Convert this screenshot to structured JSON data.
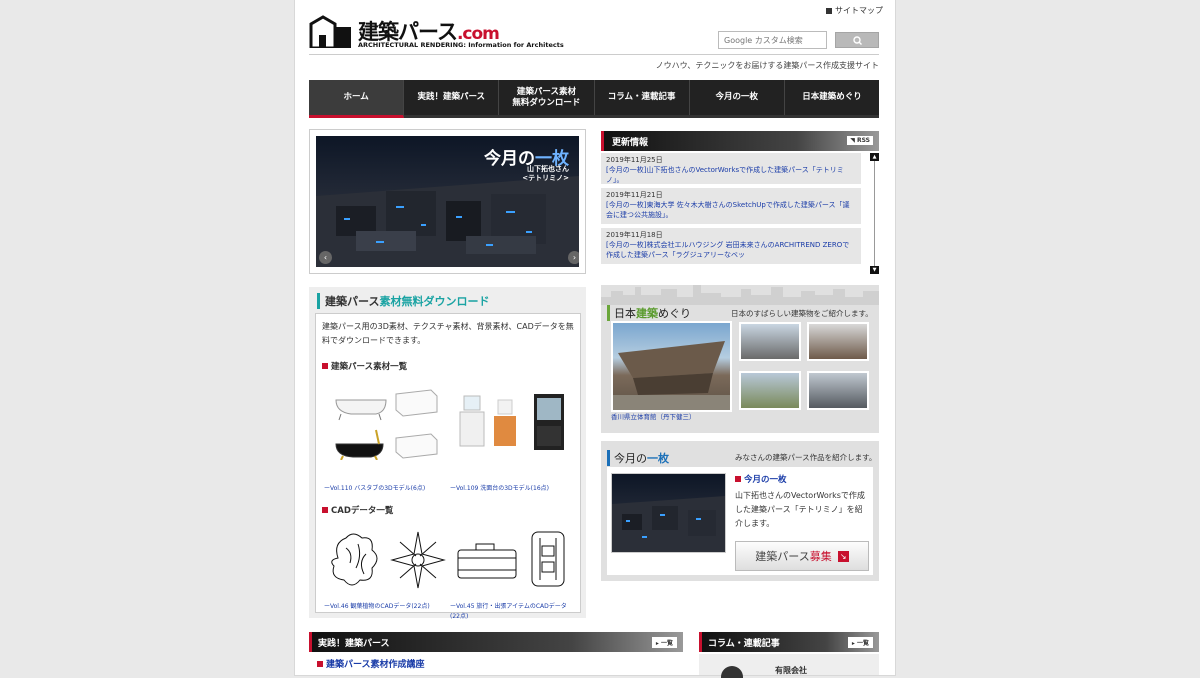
{
  "header": {
    "logo_title": "建築パース",
    "logo_domain": ".com",
    "logo_subtitle": "ARCHITECTURAL RENDERING: Information for Architects",
    "sitemap": "サイトマップ",
    "search_placeholder": "Google カスタム検索",
    "tagline": "ノウハウ、テクニックをお届けする建築パース作成支援サイト"
  },
  "nav": [
    {
      "label": "ホーム",
      "active": true
    },
    {
      "label": "実践！建築パース"
    },
    {
      "label": "建築パース素材\n無料ダウンロード"
    },
    {
      "label": "コラム・連載記事"
    },
    {
      "label": "今月の一枚"
    },
    {
      "label": "日本建築めぐり"
    }
  ],
  "slider": {
    "title_a": "今月の",
    "title_b": "一枚",
    "caption_line1": "山下拓也さん",
    "caption_line2": "<テトリミノ>"
  },
  "updates": {
    "title": "更新情報",
    "rss": "RSS",
    "items": [
      {
        "date": "2019年11月25日",
        "text": "[今月の一枚]山下拓也さんのVectorWorksで作成した建築パース「テトリミノ」。"
      },
      {
        "date": "2019年11月21日",
        "text": "[今月の一枚]東海大学 佐々木大樹さんのSketchUpで作成した建築パース「議会に建つ公共施設」。"
      },
      {
        "date": "2019年11月18日",
        "text": "[今月の一枚]株式会社エルハウジング 岩田未来さんのARCHITREND ZEROで作成した建築パース「ラグジュアリーなベッ"
      }
    ]
  },
  "download": {
    "title_a": "建築パース",
    "title_b": "素材無料ダウンロード",
    "intro": "建築パース用の3D素材、テクスチャ素材、背景素材、CADデータを無料でダウンロードできます。",
    "materials_heading": "建築パース素材一覧",
    "material_links": [
      "ーVol.110 バスタブの3Dモデル(6点)",
      "ーVol.109 洗面台の3Dモデル(16点)"
    ],
    "cad_heading": "CADデータ一覧",
    "cad_links": [
      "ーVol.46 観葉植物のCADデータ(22点)",
      "ーVol.45 旅行・出張アイテムのCADデータ(22点)"
    ]
  },
  "tour": {
    "title_a": "日本",
    "title_b": "建築",
    "title_c": "めぐり",
    "description": "日本のすばらしい建築物をご紹介します。",
    "main_caption": "香川県立体育館（丹下健三）"
  },
  "month": {
    "title_a": "今月の",
    "title_b": "一枚",
    "description": "みなさんの建築パース作品を紹介します。",
    "heading": "今月の一枚",
    "text": "山下拓也さんのVectorWorksで作成した建築パース「テトリミノ」を紹介します。",
    "button_a": "建築パース",
    "button_b": "募集"
  },
  "bottom": {
    "practice_title": "実践！建築パース",
    "practice_more": "一覧",
    "practice_link": "建築パース素材作成講座",
    "column_title": "コラム・連載記事",
    "column_more": "一覧",
    "column_company": "有限会社"
  },
  "colors": {
    "accent_red": "#c8102e",
    "teal": "#1aa3a3",
    "green": "#5b9b2e",
    "blue": "#1a6fb8",
    "link": "#1a3ca8"
  }
}
